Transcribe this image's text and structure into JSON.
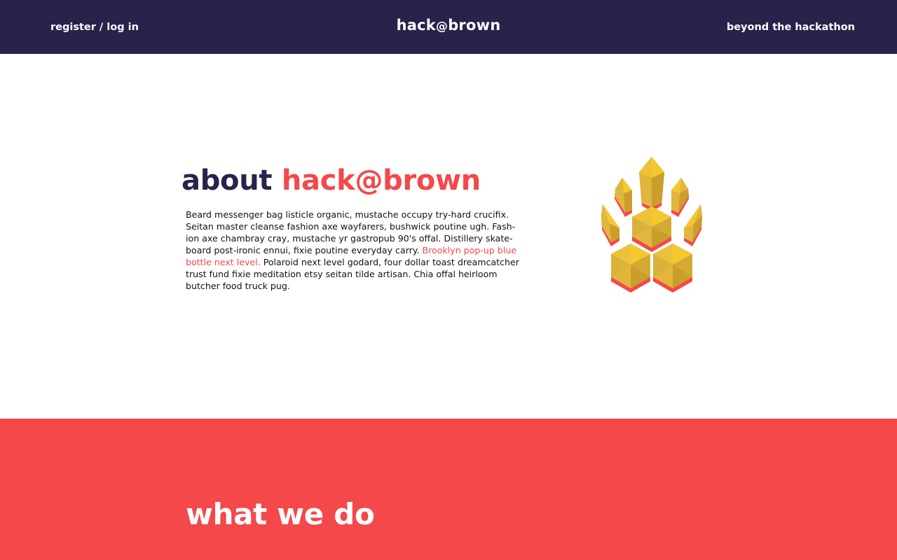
{
  "nav": {
    "left_link": "register / log in",
    "brand_prefix": "hack",
    "brand_at": "@",
    "brand_suffix": "brown",
    "right_link": "beyond the hackathon"
  },
  "about": {
    "title_part1": "about",
    "title_part2": "hack@brown",
    "body_before_link": "Beard messenger bag listicle organic, mustache occupy try-hard crucifix. Seitan master cleanse fashion axe wayfarers, bushwick poutine ugh. Fash-ion axe chambray cray, mustache yr gastropub 90's offal. Distillery skate-board post-ironic ennui, fixie poutine everyday carry. ",
    "body_link": "Brooklyn pop-up blue bottle next level.",
    "body_after_link": " Polaroid next level godard, four dollar toast dreamcatcher trust fund fixie meditation etsy seitan tilde artisan. Chia offal heirloom butcher food truck pug.",
    "logo_icon": "paw-crystal-logo-icon"
  },
  "what": {
    "title": "what we do"
  },
  "colors": {
    "navy": "#29224b",
    "coral": "#f4484a",
    "gold": "#e2b63c",
    "gold_light": "#f5c92e",
    "gold_dark": "#c99e2c",
    "white": "#ffffff"
  }
}
